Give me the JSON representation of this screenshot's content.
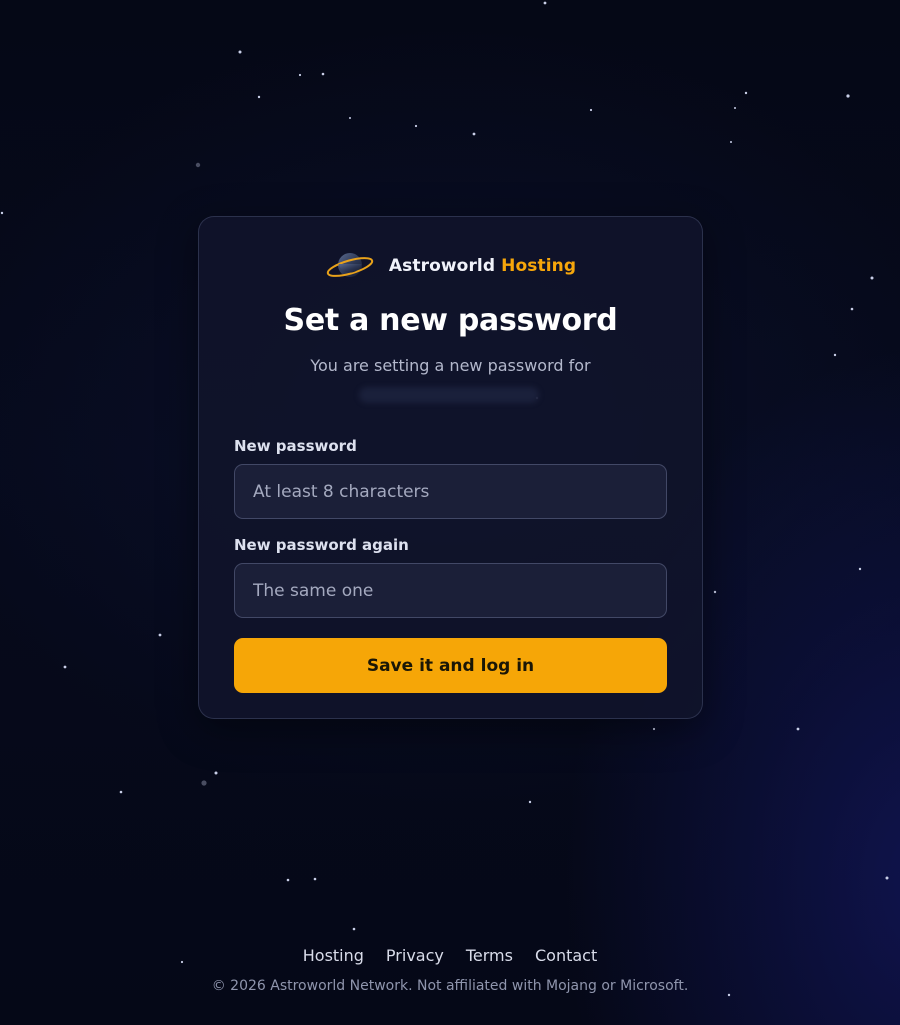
{
  "background": {
    "accent": "#151a78"
  },
  "brand": {
    "name_primary": "Astroworld",
    "name_accent": "Hosting",
    "logo_icon": "planet-with-ring-icon",
    "accent_color": "#f6a60b"
  },
  "form": {
    "title": "Set a new password",
    "subtitle": "You are setting a new password for",
    "new_password": {
      "label": "New password",
      "placeholder": "At least 8 characters",
      "value": ""
    },
    "confirm_password": {
      "label": "New password again",
      "placeholder": "The same one",
      "value": ""
    },
    "submit_label": "Save it and log in",
    "submit_color": "#f6a607"
  },
  "footer": {
    "links": [
      {
        "label": "Hosting"
      },
      {
        "label": "Privacy"
      },
      {
        "label": "Terms"
      },
      {
        "label": "Contact"
      }
    ],
    "copyright": "© 2026 Astroworld Network. Not affiliated with Mojang or Microsoft."
  }
}
